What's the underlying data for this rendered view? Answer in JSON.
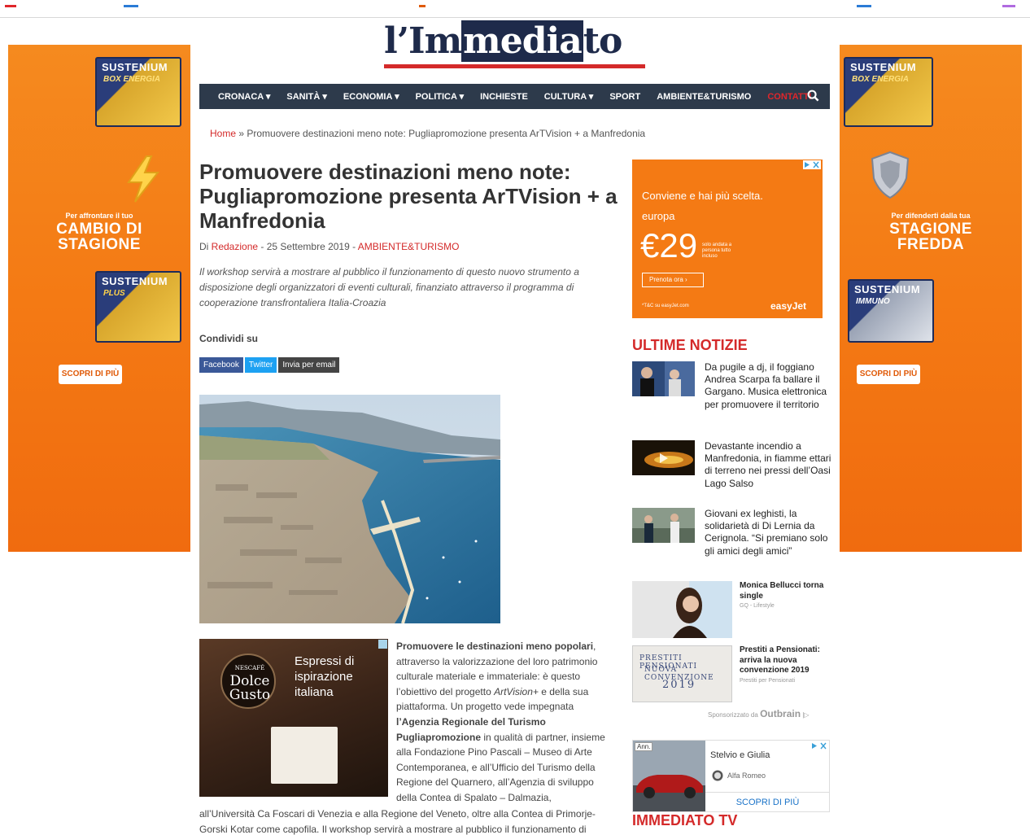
{
  "logo": {
    "pre": "l’Im",
    "highlight": "media",
    "post": "to"
  },
  "nav": {
    "items": [
      {
        "label": "CRONACA ▾"
      },
      {
        "label": "SANITÀ ▾"
      },
      {
        "label": "ECONOMIA ▾"
      },
      {
        "label": "POLITICA ▾"
      },
      {
        "label": "INCHIESTE"
      },
      {
        "label": "CULTURA ▾"
      },
      {
        "label": "SPORT"
      },
      {
        "label": "AMBIENTE&TURISMO"
      },
      {
        "label": "CONTATTI"
      }
    ],
    "search_icon": "search-icon"
  },
  "breadcrumb": {
    "home": "Home",
    "sep": " » ",
    "current": "Promuovere destinazioni meno note: Pugliapromozione presenta ArTVision + a Manfredonia"
  },
  "article": {
    "title": "Promuovere destinazioni meno note: Pugliapromozione presenta ArTVision + a Manfredonia",
    "by_prefix": "Di ",
    "author": "Redazione",
    "date": " - 25 Settembre 2019 - ",
    "category": "AMBIENTE&TURISMO",
    "excerpt": "Il workshop servirà a mostrare al pubblico il funzionamento di questo nuovo strumento a disposizione degli organizzatori di eventi culturali, finanziato attraverso il programma di cooperazione transfrontaliera Italia-Croazia",
    "share_label": "Condividi su",
    "share": {
      "facebook": "Facebook",
      "twitter": "Twitter",
      "email": "Invia per email"
    },
    "body_lead": "Promuovere le destinazioni meno popolari",
    "body_1": ", attraverso la valorizzazione del loro patrimonio culturale materiale e immateriale: è questo l’obiettivo del progetto ",
    "body_italic": "ArtVision+",
    "body_2": " e della sua piattaforma. Un progetto vede impegnata ",
    "body_bold2": "l’Agenzia Regionale del Turismo Pugliapromozione",
    "body_3": " in qualità di partner, insieme alla Fondazione Pino Pascali – Museo di Arte Contemporanea, e all’Ufficio del Turismo della Regione del Quarnero, all’Agenzia di sviluppo della Contea di Spalato – Dalmazia,",
    "body_4": "all’Università Ca Foscari di Venezia e alla Regione del Veneto, oltre alla Contea di Primorje-Gorski Kotar come capofila. Il workshop servirà a mostrare al pubblico il funzionamento di"
  },
  "side_ads": {
    "left": {
      "brand": "SUSTENIUM",
      "sub1": "BOX ENERGIA",
      "small": "Per affrontare il tuo",
      "big1": "CAMBIO DI",
      "big2": "STAGIONE",
      "brand2": "SUSTENIUM",
      "sub2": "PLUS",
      "cta": "SCOPRI DI PIÙ"
    },
    "right": {
      "brand": "SUSTENIUM",
      "sub1": "BOX ENERGIA",
      "small": "Per difenderti dalla tua",
      "big1": "STAGIONE",
      "big2": "FREDDA",
      "brand2": "SUSTENIUM",
      "sub2": "IMMUNO",
      "cta": "SCOPRI DI PIÙ"
    }
  },
  "inline_ad": {
    "brand1": "NESCAFÉ",
    "brand2": "Dolce",
    "brand3": "Gusto",
    "headline": "Espressi di ispirazione italiana"
  },
  "easyjet_ad": {
    "line1": "Conviene e hai più scelta.",
    "line2": "europa",
    "price": "€29",
    "fine": "solo andata a persona tutto incluso",
    "cta": "Prenota ora  ›",
    "tc": "*T&C su easyJet.com",
    "brand": "easyJet"
  },
  "ultime": {
    "title": "ULTIME NOTIZIE",
    "items": [
      {
        "text": "Da pugile a dj, il foggiano Andrea Scarpa fa ballare il Gargano. Musica elettronica per promuovere il territorio"
      },
      {
        "text": "Devastante incendio a Manfredonia, in fiamme ettari di terreno nei pressi dell’Oasi Lago Salso"
      },
      {
        "text": "Giovani ex leghisti, la solidarietà di Di Lernia da Cerignola. “Si premiano solo gli amici degli amici”"
      }
    ]
  },
  "outbrain": {
    "items": [
      {
        "title": "Monica Bellucci torna single",
        "source": "GQ - Lifestyle"
      },
      {
        "title": "Prestiti a Pensionati: arriva la nuova convenzione 2019",
        "source": "Prestiti per Pensionati",
        "thumb_line1": "PRESTITI PENSIONATI",
        "thumb_line2": "NUOVA CONVENZIONE",
        "thumb_year": "2019"
      }
    ],
    "footer": "Sponsorizzato da",
    "brand": "Outbrain",
    "tail": " |▷"
  },
  "alfa_ad": {
    "badge": "Ann.",
    "title": "Stelvio e Giulia",
    "brand": "Alfa Romeo",
    "cta": "SCOPRI DI PIÙ"
  },
  "tv": {
    "title": "IMMEDIATO TV"
  },
  "colors": {
    "brand_red": "#d42a2a",
    "nav_bg": "#2d3a4b",
    "ad_orange": "#f47a14"
  }
}
